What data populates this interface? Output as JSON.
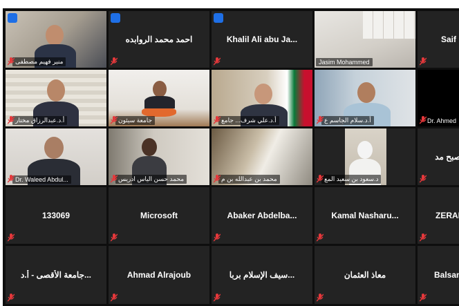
{
  "meeting": {
    "participants": [
      {
        "id": "p1",
        "name": "منير فهيم مصطفى",
        "video": true,
        "hand_raised": true,
        "mic": "muted"
      },
      {
        "id": "p2",
        "name": "احمد محمد الروابده",
        "video": false,
        "hand_raised": true,
        "mic": "muted"
      },
      {
        "id": "p3",
        "name": "Khalil Ali abu Ja...",
        "video": false,
        "hand_raised": true,
        "mic": "muted"
      },
      {
        "id": "p4",
        "name": "Jasim Mohammed",
        "video": true,
        "hand_raised": false,
        "mic": "none"
      },
      {
        "id": "p5",
        "name": "Saif",
        "video": false,
        "hand_raised": false,
        "mic": "muted"
      },
      {
        "id": "p6",
        "name": "أ.د.عبدالرزاق مختار",
        "video": true,
        "hand_raised": false,
        "mic": "muted"
      },
      {
        "id": "p7",
        "name": "جامعة سيئون",
        "video": true,
        "hand_raised": false,
        "mic": "muted"
      },
      {
        "id": "p8",
        "name": "أ.د.علي شرف... جامع",
        "video": true,
        "hand_raised": false,
        "mic": "muted"
      },
      {
        "id": "p9",
        "name": "أ.د.سلام الجاسم ع",
        "video": true,
        "hand_raised": false,
        "mic": "muted"
      },
      {
        "id": "p10",
        "name": "Dr. Ahmed",
        "video": true,
        "hand_raised": false,
        "mic": "muted"
      },
      {
        "id": "p11",
        "name": "Dr. Waleed Abdul...",
        "video": true,
        "hand_raised": false,
        "mic": "muted"
      },
      {
        "id": "p12",
        "name": "محمد حسن الياس ادريس",
        "video": true,
        "hand_raised": false,
        "mic": "muted"
      },
      {
        "id": "p13",
        "name": "محمد بن عبدالله بن م",
        "video": true,
        "hand_raised": false,
        "mic": "muted"
      },
      {
        "id": "p14",
        "name": "د.سعود بن سعيد المع",
        "video": true,
        "hand_raised": false,
        "mic": "muted"
      },
      {
        "id": "p15",
        "name": "صبح مد",
        "video": false,
        "hand_raised": false,
        "mic": "muted"
      },
      {
        "id": "p16",
        "name": "133069",
        "video": false,
        "hand_raised": false,
        "mic": "muted"
      },
      {
        "id": "p17",
        "name": "Microsoft",
        "video": false,
        "hand_raised": false,
        "mic": "muted"
      },
      {
        "id": "p18",
        "name": "Abaker Abdelba...",
        "video": false,
        "hand_raised": false,
        "mic": "muted"
      },
      {
        "id": "p19",
        "name": "Kamal Nasharu...",
        "video": false,
        "hand_raised": false,
        "mic": "muted"
      },
      {
        "id": "p20",
        "name": "ZERAD",
        "video": false,
        "hand_raised": false,
        "mic": "muted"
      },
      {
        "id": "p21",
        "name": "جامعة الأقصى - أ.د...",
        "video": false,
        "hand_raised": false,
        "mic": "muted"
      },
      {
        "id": "p22",
        "name": "Ahmad Alrajoub",
        "video": false,
        "hand_raised": false,
        "mic": "muted"
      },
      {
        "id": "p23",
        "name": "سيف الإسلام بربا...",
        "video": false,
        "hand_raised": false,
        "mic": "muted"
      },
      {
        "id": "p24",
        "name": "معاذ العثمان",
        "video": false,
        "hand_raised": false,
        "mic": "muted"
      },
      {
        "id": "p25",
        "name": "Balsam",
        "video": false,
        "hand_raised": false,
        "mic": "muted"
      }
    ]
  },
  "colors": {
    "grid_bg": "#0e0e0e",
    "tile_bg": "#232323",
    "muted_mic": "#e5383b",
    "hand_raise": "#1e6fe6"
  }
}
